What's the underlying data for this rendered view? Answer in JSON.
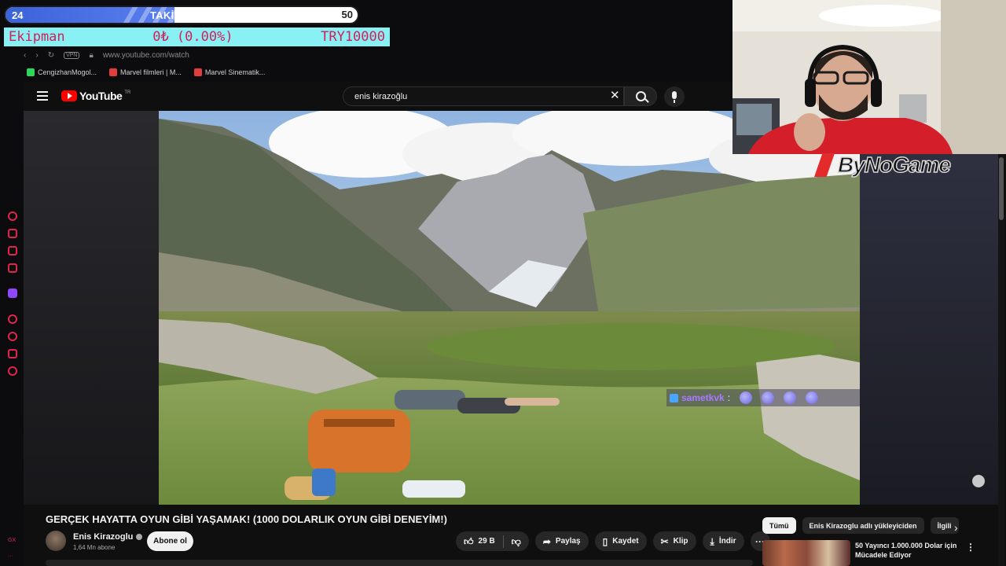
{
  "overlay": {
    "followers": {
      "current": "24",
      "title": "TAKİPÇİLER",
      "goal": "50",
      "progress": 0.48
    },
    "equipment": {
      "name": "Ekipman",
      "amount": "0₺ (0.00%)",
      "target": "TRY10000"
    }
  },
  "browser": {
    "vpn_label": "VPN",
    "url": "www.youtube.com/watch",
    "bookmarks": [
      {
        "label": "CengizhanMogol...",
        "color": "#2bd65a"
      },
      {
        "label": "Marvel filmleri | M...",
        "color": "#e23c3c"
      },
      {
        "label": "Marvel Sinematik...",
        "color": "#e23c3c"
      }
    ]
  },
  "youtube": {
    "logo_text": "YouTube",
    "logo_region": "TR",
    "search_value": "enis kirazoğlu",
    "video": {
      "title": "GERÇEK HAYATTA OYUN GİBİ YAŞAMAK! (1000 DOLARLIK OYUN GİBİ DENEYİM!)",
      "channel": "Enis Kirazoglu",
      "subscribers": "1,64 Mn abone",
      "subscribe_label": "Abone ol",
      "likes": "29 B",
      "share_label": "Paylaş",
      "save_label": "Kaydet",
      "clip_label": "Klip",
      "download_label": "İndir"
    },
    "chips": [
      "Tümü",
      "Enis Kirazoglu adlı yükleyiciden",
      "İlgili"
    ],
    "recommendation": {
      "title": "50 Yayıncı 1.000.000 Dolar için Mücadele Ediyor"
    }
  },
  "chat": {
    "username": "sametkvk",
    "separator": ":"
  },
  "sponsor": {
    "brand": "ByNoGame"
  },
  "dock": {
    "footer": "GX"
  },
  "colors": {
    "accent_red": "#e0254c",
    "twitch_purple": "#9146ff",
    "equip_bg": "#89f1f4",
    "follow_fill": "#3b63d8"
  }
}
